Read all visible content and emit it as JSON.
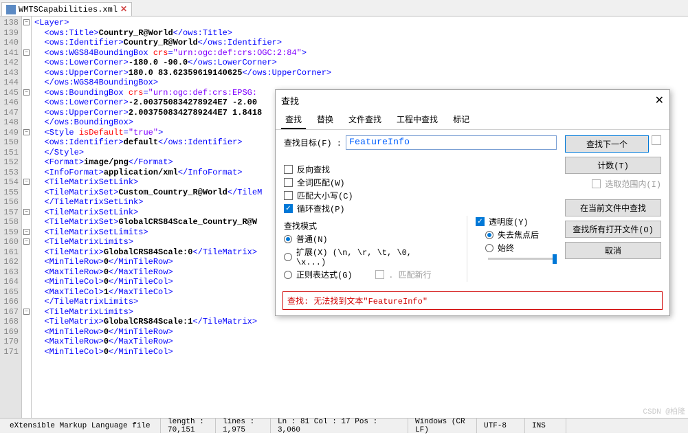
{
  "tab": {
    "filename": "WMTSCapabilities.xml"
  },
  "gutter": {
    "start": 138,
    "end": 171
  },
  "code_lines": [
    {
      "i": 0,
      "html": "<span class='t-tag'>&lt;Layer&gt;</span>"
    },
    {
      "i": 1,
      "html": "  <span class='t-tag'>&lt;ows:Title&gt;</span><span class='t-txt'>Country_R@World</span><span class='t-tag'>&lt;/ows:Title&gt;</span>"
    },
    {
      "i": 2,
      "html": "  <span class='t-tag'>&lt;ows:Identifier&gt;</span><span class='t-txt'>Country_R@World</span><span class='t-tag'>&lt;/ows:Identifier&gt;</span>"
    },
    {
      "i": 3,
      "html": "  <span class='t-tag'>&lt;ows:WGS84BoundingBox</span> <span class='t-attr'>crs</span><span class='t-tag'>=</span><span class='t-val'>\"urn:ogc:def:crs:OGC:2:84\"</span><span class='t-tag'>&gt;</span>"
    },
    {
      "i": 4,
      "html": "  <span class='t-tag'>&lt;ows:LowerCorner&gt;</span><span class='t-txt'>-180.0 -90.0</span><span class='t-tag'>&lt;/ows:LowerCorner&gt;</span>"
    },
    {
      "i": 5,
      "html": "  <span class='t-tag'>&lt;ows:UpperCorner&gt;</span><span class='t-txt'>180.0 83.62359619140625</span><span class='t-tag'>&lt;/ows:UpperCorner&gt;</span>"
    },
    {
      "i": 6,
      "html": "  <span class='t-tag'>&lt;/ows:WGS84BoundingBox&gt;</span>"
    },
    {
      "i": 7,
      "html": "  <span class='t-tag'>&lt;ows:BoundingBox</span> <span class='t-attr'>crs</span><span class='t-tag'>=</span><span class='t-val'>\"urn:ogc:def:crs:EPSG:</span>"
    },
    {
      "i": 8,
      "html": "  <span class='t-tag'>&lt;ows:LowerCorner&gt;</span><span class='t-txt'>-2.003750834278924E7 -2.00</span>"
    },
    {
      "i": 9,
      "html": "  <span class='t-tag'>&lt;ows:UpperCorner&gt;</span><span class='t-txt'>2.0037508342789244E7 1.8418</span>"
    },
    {
      "i": 10,
      "html": "  <span class='t-tag'>&lt;/ows:BoundingBox&gt;</span>"
    },
    {
      "i": 11,
      "html": "  <span class='t-tag'>&lt;Style</span> <span class='t-attr'>isDefault</span><span class='t-tag'>=</span><span class='t-val'>\"true\"</span><span class='t-tag'>&gt;</span>"
    },
    {
      "i": 12,
      "html": "  <span class='t-tag'>&lt;ows:Identifier&gt;</span><span class='t-txt'>default</span><span class='t-tag'>&lt;/ows:Identifier&gt;</span>"
    },
    {
      "i": 13,
      "html": "  <span class='t-tag'>&lt;/Style&gt;</span>"
    },
    {
      "i": 14,
      "html": "  <span class='t-tag'>&lt;Format&gt;</span><span class='t-txt'>image/png</span><span class='t-tag'>&lt;/Format&gt;</span>"
    },
    {
      "i": 15,
      "html": "  <span class='t-tag'>&lt;InfoFormat&gt;</span><span class='t-txt'>application/xml</span><span class='t-tag'>&lt;/InfoFormat&gt;</span>"
    },
    {
      "i": 16,
      "html": "  <span class='t-tag'>&lt;TileMatrixSetLink&gt;</span>"
    },
    {
      "i": 17,
      "html": "  <span class='t-tag'>&lt;TileMatrixSet&gt;</span><span class='t-txt'>Custom_Country_R@World</span><span class='t-tag'>&lt;/TileM</span>"
    },
    {
      "i": 18,
      "html": "  <span class='t-tag'>&lt;/TileMatrixSetLink&gt;</span>"
    },
    {
      "i": 19,
      "html": "  <span class='t-tag'>&lt;TileMatrixSetLink&gt;</span>"
    },
    {
      "i": 20,
      "html": "  <span class='t-tag'>&lt;TileMatrixSet&gt;</span><span class='t-txt'>GlobalCRS84Scale_Country_R@W</span>"
    },
    {
      "i": 21,
      "html": "  <span class='t-tag'>&lt;TileMatrixSetLimits&gt;</span>"
    },
    {
      "i": 22,
      "html": "  <span class='t-tag'>&lt;TileMatrixLimits&gt;</span>"
    },
    {
      "i": 23,
      "html": "  <span class='t-tag'>&lt;TileMatrix&gt;</span><span class='t-txt'>GlobalCRS84Scale:0</span><span class='t-tag'>&lt;/TileMatrix&gt;</span>"
    },
    {
      "i": 24,
      "html": "  <span class='t-tag'>&lt;MinTileRow&gt;</span><span class='t-txt'>0</span><span class='t-tag'>&lt;/MinTileRow&gt;</span>"
    },
    {
      "i": 25,
      "html": "  <span class='t-tag'>&lt;MaxTileRow&gt;</span><span class='t-txt'>0</span><span class='t-tag'>&lt;/MaxTileRow&gt;</span>"
    },
    {
      "i": 26,
      "html": "  <span class='t-tag'>&lt;MinTileCol&gt;</span><span class='t-txt'>0</span><span class='t-tag'>&lt;/MinTileCol&gt;</span>"
    },
    {
      "i": 27,
      "html": "  <span class='t-tag'>&lt;MaxTileCol&gt;</span><span class='t-txt'>1</span><span class='t-tag'>&lt;/MaxTileCol&gt;</span>"
    },
    {
      "i": 28,
      "html": "  <span class='t-tag'>&lt;/TileMatrixLimits&gt;</span>"
    },
    {
      "i": 29,
      "html": "  <span class='t-tag'>&lt;TileMatrixLimits&gt;</span>"
    },
    {
      "i": 30,
      "html": "  <span class='t-tag'>&lt;TileMatrix&gt;</span><span class='t-txt'>GlobalCRS84Scale:1</span><span class='t-tag'>&lt;/TileMatrix&gt;</span>"
    },
    {
      "i": 31,
      "html": "  <span class='t-tag'>&lt;MinTileRow&gt;</span><span class='t-txt'>0</span><span class='t-tag'>&lt;/MinTileRow&gt;</span>"
    },
    {
      "i": 32,
      "html": "  <span class='t-tag'>&lt;MaxTileRow&gt;</span><span class='t-txt'>0</span><span class='t-tag'>&lt;/MaxTileRow&gt;</span>"
    },
    {
      "i": 33,
      "html": "  <span class='t-tag'>&lt;MinTileCol&gt;</span><span class='t-txt'>0</span><span class='t-tag'>&lt;/MinTileCol&gt;</span>"
    }
  ],
  "fold_marks": [
    0,
    3,
    7,
    11,
    16,
    19,
    21,
    22,
    29
  ],
  "dialog": {
    "title": "查找",
    "tabs": [
      "查找",
      "替换",
      "文件查找",
      "工程中查找",
      "标记"
    ],
    "active_tab": 0,
    "target_label": "查找目标(F) :",
    "target_value": "FeatureInfo",
    "backward": "反向查找",
    "wholeword": "全词匹配(W)",
    "matchcase": "匹配大小写(C)",
    "wrap": "循环查找(P)",
    "mode_label": "查找模式",
    "mode_normal": "普通(N)",
    "mode_extended": "扩展(X) (\\n, \\r, \\t, \\0, \\x...)",
    "mode_regex": "正则表达式(G)",
    "match_newline": ". 匹配新行",
    "in_range": "选取范围内(I)",
    "transp_label": "透明度(Y)",
    "transp_onblur": "失去焦点后",
    "transp_always": "始终",
    "btn_findnext": "查找下一个",
    "btn_count": "计数(T)",
    "btn_findcurrent": "在当前文件中查找",
    "btn_findall": "查找所有打开文件(O)",
    "btn_cancel": "取消",
    "status": "查找: 无法找到文本\"FeatureInfo\""
  },
  "statusbar": {
    "lang": "eXtensible Markup Language file",
    "length": "length : 70,151",
    "lines": "lines : 1,975",
    "pos": "Ln : 81    Col : 17    Pos : 3,060",
    "eol": "Windows (CR LF)",
    "enc": "UTF-8",
    "ins": "INS"
  },
  "watermark": "CSDN @柏隆"
}
